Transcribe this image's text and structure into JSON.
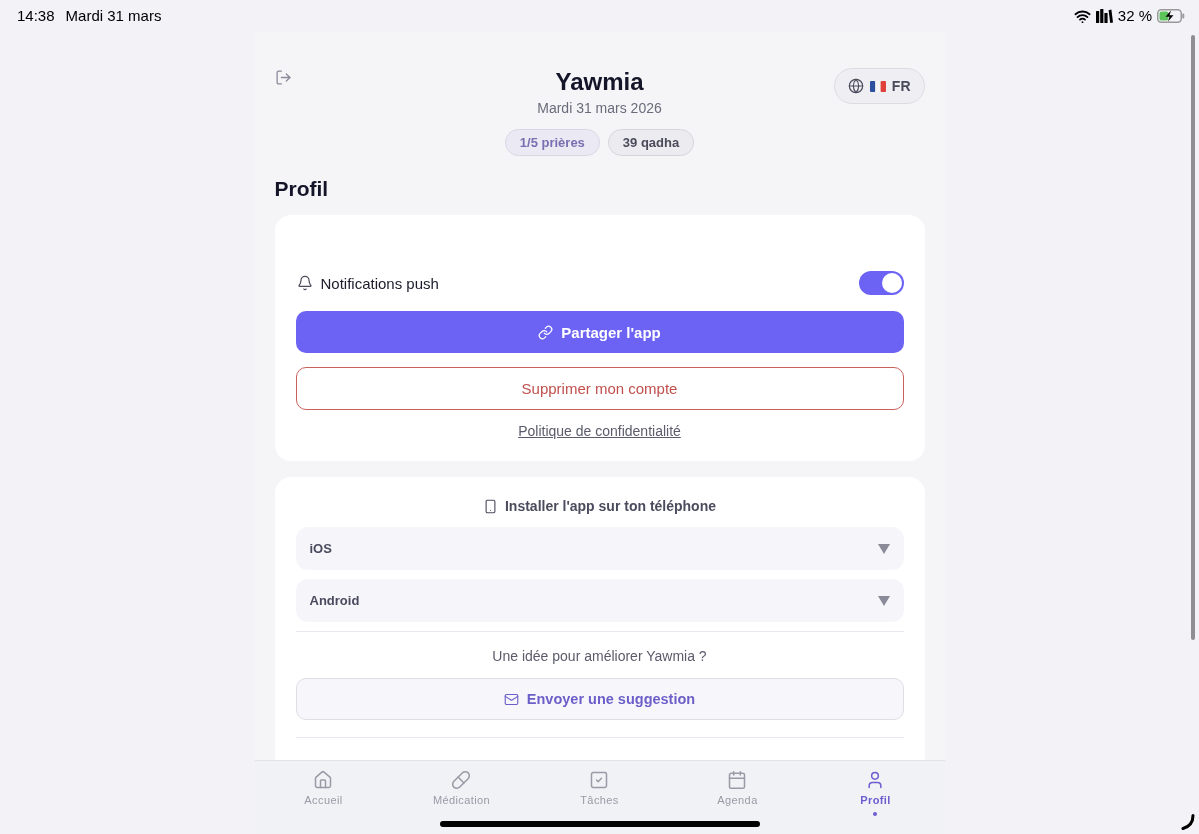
{
  "status_bar": {
    "time": "14:38",
    "date": "Mardi 31 mars",
    "battery": "32 %"
  },
  "header": {
    "title": "Yawmia",
    "date": "Mardi 31 mars 2026",
    "badges": [
      {
        "kind": "prayers",
        "text": "1/5 prières"
      },
      {
        "kind": "qadha",
        "text": "39 qadha"
      }
    ],
    "language": "FR"
  },
  "page_title": "Profil",
  "settings_card": {
    "notifications": {
      "label": "Notifications push",
      "on": true
    },
    "share_button": "Partager l'app",
    "delete_button": "Supprimer mon compte",
    "privacy_link": "Politique de confidentialité"
  },
  "install_card": {
    "title": "Installer l'app sur ton téléphone",
    "platforms": [
      {
        "label": "iOS",
        "expanded": false
      },
      {
        "label": "Android",
        "expanded": false
      }
    ],
    "suggestion_prompt": "Une idée pour améliorer Yawmia ?",
    "suggestion_button": "Envoyer une suggestion"
  },
  "bottom_nav": [
    {
      "kind": "home",
      "label": "Accueil",
      "selected": false
    },
    {
      "kind": "medication",
      "label": "Médication",
      "selected": false
    },
    {
      "kind": "tasks",
      "label": "Tâches",
      "selected": false
    },
    {
      "kind": "calendar",
      "label": "Agenda",
      "selected": false
    },
    {
      "kind": "profile",
      "label": "Profil",
      "selected": true
    }
  ]
}
